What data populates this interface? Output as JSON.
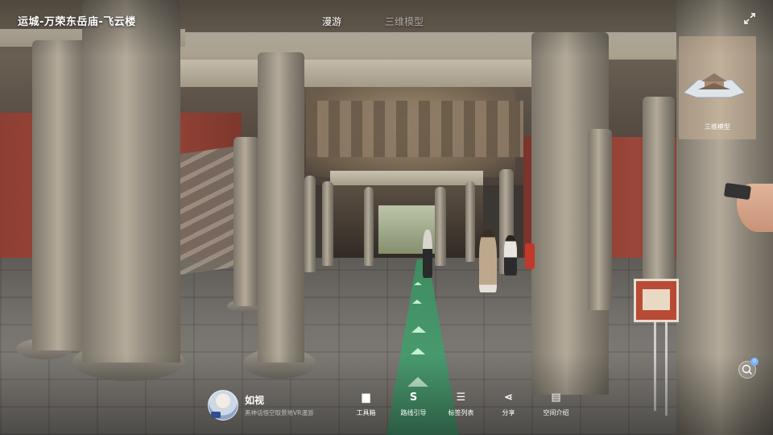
{
  "header": {
    "title": "运城-万荣东岳庙-飞云楼",
    "tabs": [
      {
        "label": "漫游",
        "active": true
      },
      {
        "label": "三维模型",
        "active": false
      }
    ],
    "expand_icon": "expand-arrows-icon"
  },
  "model_thumbnail": {
    "label": "三维模型",
    "icon": "building-model-icon"
  },
  "brand": {
    "name": "如视",
    "subtitle": "黑神话悟空取景地VR漫游"
  },
  "toolbar": {
    "items": [
      {
        "label": "工具箱",
        "icon": "toolbox-icon",
        "glyph": "▆"
      },
      {
        "label": "路线引导",
        "icon": "route-guide-icon",
        "glyph": "S"
      },
      {
        "label": "标签列表",
        "icon": "tag-list-icon",
        "glyph": "☰"
      },
      {
        "label": "分享",
        "icon": "share-icon",
        "glyph": "⋖"
      },
      {
        "label": "空间介绍",
        "icon": "space-intro-icon",
        "glyph": "▤"
      }
    ]
  },
  "zoom_button": {
    "badge": "0"
  },
  "colors": {
    "route_path": "#4aa777",
    "accent": "#7ab0ff"
  }
}
